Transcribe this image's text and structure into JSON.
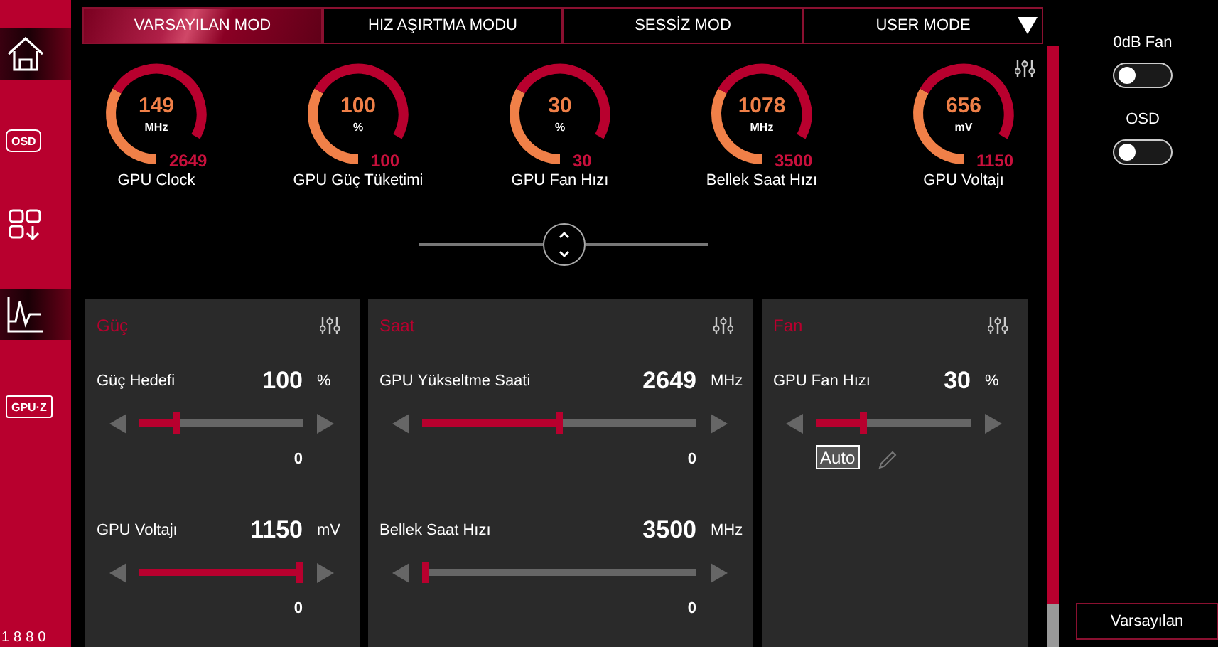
{
  "sidebar": {
    "items": [
      {
        "kind": "home",
        "selected": true
      },
      {
        "kind": "osd",
        "label": "OSD",
        "selected": false
      },
      {
        "kind": "apps",
        "selected": false
      },
      {
        "kind": "monitor",
        "selected": true
      },
      {
        "kind": "gpuz",
        "label": "GPU·Z",
        "selected": false
      }
    ],
    "footer": "1880"
  },
  "tabs": [
    {
      "label": "VARSAYILAN MOD",
      "selected": true
    },
    {
      "label": "HIZ AŞIRTMA MODU",
      "selected": false
    },
    {
      "label": "SESSİZ MOD",
      "selected": false
    },
    {
      "label": "USER MODE",
      "selected": false,
      "dropdown": true
    }
  ],
  "gauges": [
    {
      "value": "149",
      "unit": "MHz",
      "max": "2649",
      "label": "GPU Clock"
    },
    {
      "value": "100",
      "unit": "%",
      "max": "100",
      "label": "GPU Güç Tüketimi"
    },
    {
      "value": "30",
      "unit": "%",
      "max": "30",
      "label": "GPU Fan Hızı"
    },
    {
      "value": "1078",
      "unit": "MHz",
      "max": "3500",
      "label": "Bellek Saat Hızı"
    },
    {
      "value": "656",
      "unit": "mV",
      "max": "1150",
      "label": "GPU Voltajı"
    }
  ],
  "panels": [
    {
      "title": "Güç",
      "sliders": [
        {
          "label": "Güç Hedefi",
          "value": "100",
          "unit": "%",
          "level": 0.22,
          "reading": "0"
        },
        {
          "label": "GPU Voltajı",
          "value": "1150",
          "unit": "mV",
          "level": 1,
          "reading": "0"
        }
      ]
    },
    {
      "title": "Saat",
      "sliders": [
        {
          "label": "GPU Yükseltme Saati",
          "value": "2649",
          "unit": "MHz",
          "level": 0.5,
          "reading": "0"
        },
        {
          "label": "Bellek Saat Hızı",
          "value": "3500",
          "unit": "MHz",
          "level": 0,
          "reading": "0"
        }
      ]
    },
    {
      "title": "Fan",
      "sliders": [
        {
          "label": "GPU Fan Hızı",
          "value": "30",
          "unit": "%",
          "level": 0.3
        }
      ],
      "auto_button": "Auto"
    }
  ],
  "toggles": [
    {
      "label": "0dB Fan",
      "on": false
    },
    {
      "label": "OSD",
      "on": false
    }
  ],
  "default_button": "Varsayılan"
}
